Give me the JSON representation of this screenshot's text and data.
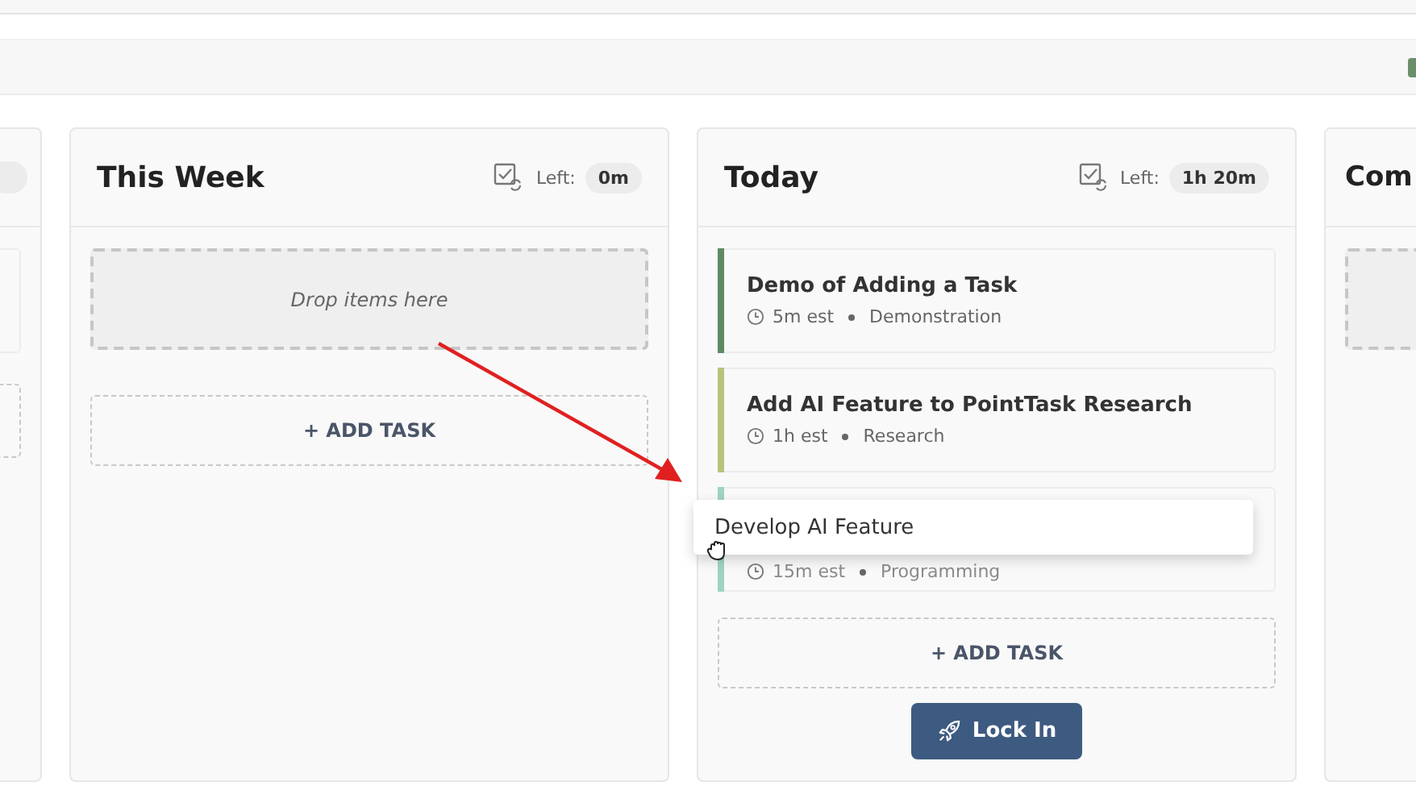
{
  "columns": [
    {
      "title": "This Week",
      "left_label": "Left:",
      "left_value": "0m",
      "drop_hint": "Drop items here",
      "add_label": "+ ADD TASK"
    },
    {
      "title": "Today",
      "left_label": "Left:",
      "left_value": "1h 20m",
      "tasks": [
        {
          "title": "Demo of Adding a Task",
          "estimate": "5m est",
          "category": "Demonstration",
          "color": "#5e8a62",
          "dragging": false
        },
        {
          "title": "Add AI Feature to PointTask Research",
          "estimate": "1h est",
          "category": "Research",
          "color": "#b5c47a",
          "dragging": false
        },
        {
          "estimate": "15m est",
          "category": "Programming",
          "color": "#9fd4bf",
          "dragging": true
        }
      ],
      "add_label": "+ ADD TASK",
      "action_button": "Lock In"
    },
    {
      "title": "Com"
    }
  ],
  "drag_ghost": {
    "label": "Develop AI Feature"
  }
}
